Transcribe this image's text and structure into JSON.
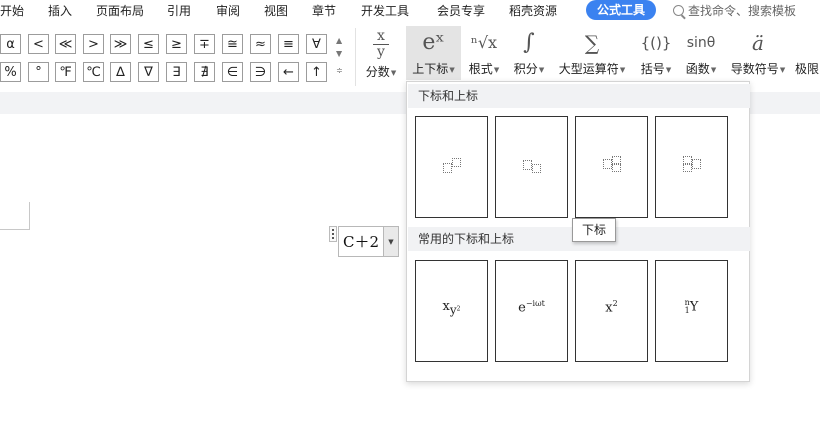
{
  "menubar": {
    "items": [
      "开始",
      "插入",
      "页面布局",
      "引用",
      "审阅",
      "视图",
      "章节",
      "开发工具",
      "会员专享",
      "稻壳资源"
    ],
    "active": "公式工具",
    "search_text": "查找命令、搜索模板"
  },
  "symbols": {
    "row1": [
      "α",
      "<",
      "≪",
      ">",
      "≫",
      "≤",
      "≥",
      "∓",
      "≅",
      "≈",
      "≡",
      "∀"
    ],
    "row2": [
      "%",
      "°",
      "℉",
      "℃",
      "∆",
      "∇",
      "∃",
      "∄",
      "∈",
      "∋",
      "←",
      "↑"
    ],
    "scroll_up": "▲",
    "scroll_down": "▲",
    "scroll_more": "≑"
  },
  "ribbon": {
    "caret": "▼",
    "fraction": {
      "icon": "x/y",
      "label": "分数"
    },
    "script": {
      "icon": "eˣ",
      "label": "上下标"
    },
    "radical": {
      "icon": "ⁿ√x",
      "label": "根式"
    },
    "integral": {
      "icon": "∫",
      "label": "积分"
    },
    "large_operator": {
      "icon": "∑",
      "label": "大型运算符"
    },
    "bracket": {
      "icon": "{()}",
      "label": "括号"
    },
    "function": {
      "icon": "sinθ",
      "label": "函数"
    },
    "accent": {
      "icon": "ä",
      "label": "导数符号"
    },
    "limit": {
      "icon": "",
      "label": "极限"
    }
  },
  "equation": {
    "text": "C＋2",
    "dropdown": "▼"
  },
  "panel": {
    "section1_title": "下标和上标",
    "section2_title": "常用的下标和上标",
    "examples": {
      "ex1": {
        "base": "x",
        "sub": "y",
        "sup": "2"
      },
      "ex2": {
        "base": "e",
        "sup": "−iωt"
      },
      "ex3": {
        "base": "x",
        "sup": "2"
      },
      "ex4": {
        "pre_sup": "n",
        "pre_sub": "1",
        "base": "Y"
      }
    }
  },
  "tooltip": "下标"
}
